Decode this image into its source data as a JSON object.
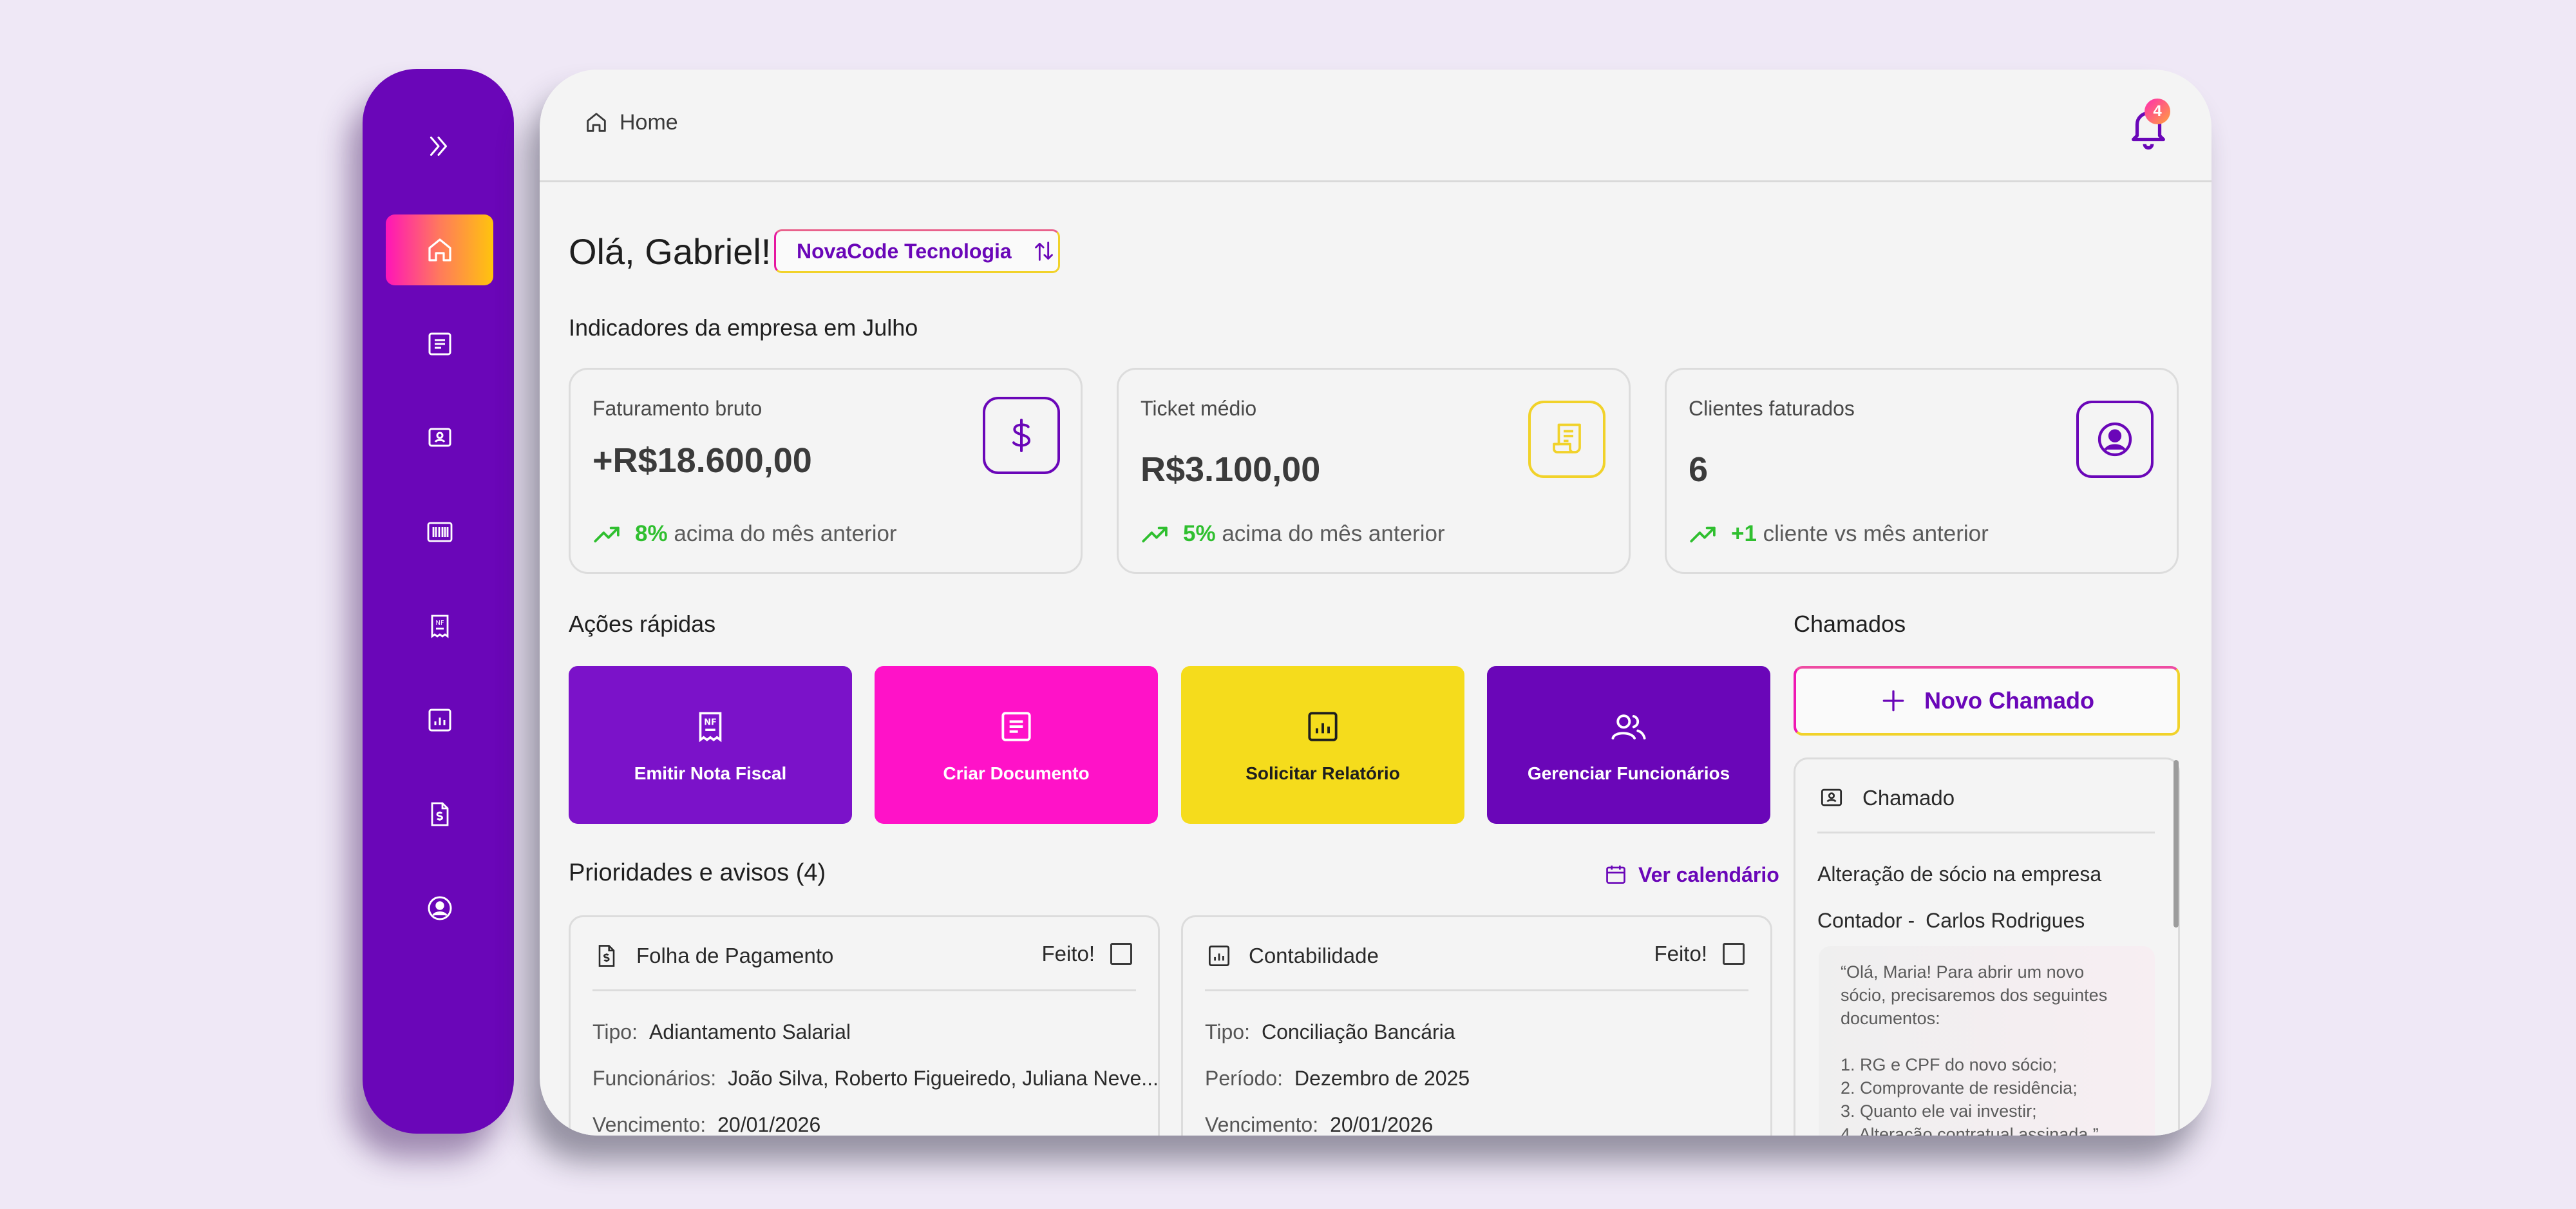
{
  "breadcrumb": {
    "label": "Home"
  },
  "notifications": {
    "count": "4"
  },
  "greeting": "Olá, Gabriel!",
  "company": {
    "name": "NovaCode Tecnologia"
  },
  "indicators": {
    "title": "Indicadores da empresa em Julho",
    "cards": [
      {
        "label": "Faturamento bruto",
        "value": "+R$18.600,00",
        "pct": "8%",
        "trend_text": "acima do mês anterior",
        "icon": "dollar-icon",
        "accent": "#6a06b8"
      },
      {
        "label": "Ticket médio",
        "value": "R$3.100,00",
        "pct": "5%",
        "trend_text": "acima do mês anterior",
        "icon": "receipt-icon",
        "accent": "#f1d22a"
      },
      {
        "label": "Clientes faturados",
        "value": "6",
        "pct": "+1",
        "trend_text": "cliente vs mês anterior",
        "icon": "user-circle-icon",
        "accent": "#6a06b8"
      }
    ]
  },
  "quick_actions": {
    "title": "Ações rápidas",
    "items": [
      {
        "label": "Emitir Nota Fiscal",
        "icon": "invoice-icon",
        "bg": "#7b12c9",
        "fg": "#ffffff"
      },
      {
        "label": "Criar Documento",
        "icon": "document-icon",
        "bg": "#ff12c8",
        "fg": "#ffffff"
      },
      {
        "label": "Solicitar Relatório",
        "icon": "report-icon",
        "bg": "#f5dc1c",
        "fg": "#1e1e1e"
      },
      {
        "label": "Gerenciar Funcionários",
        "icon": "users-icon",
        "bg": "#6a06b8",
        "fg": "#ffffff"
      }
    ]
  },
  "tickets": {
    "title": "Chamados",
    "new_button": "Novo Chamado",
    "card": {
      "header": "Chamado",
      "subject": "Alteração de sócio na empresa",
      "contact_label": "Contador -",
      "contact_name": "Carlos Rodrigues",
      "message": [
        "“Olá, Maria! Para abrir um novo",
        "sócio, precisaremos dos seguintes",
        "documentos:",
        "",
        "1. RG e CPF do novo sócio;",
        "2. Comprovante de residência;",
        "3. Quanto ele vai investir;",
        "4. Alteração contratual assinada.”"
      ]
    }
  },
  "priorities": {
    "title": "Prioridades e avisos (4)",
    "calendar_link": "Ver calendário",
    "items": [
      {
        "title": "Folha de Pagamento",
        "done_label": "Feito!",
        "icon": "payroll-icon",
        "rows": [
          {
            "label": "Tipo:",
            "value": "Adiantamento Salarial"
          },
          {
            "label": "Funcionários:",
            "value": "João Silva, Roberto Figueiredo, Juliana Neve..."
          },
          {
            "label": "Vencimento:",
            "value": "20/01/2026"
          }
        ]
      },
      {
        "title": "Contabilidade",
        "done_label": "Feito!",
        "icon": "report-icon",
        "rows": [
          {
            "label": "Tipo:",
            "value": "Conciliação Bancária"
          },
          {
            "label": "Período:",
            "value": "Dezembro de 2025"
          },
          {
            "label": "Vencimento:",
            "value": "20/01/2026"
          }
        ]
      }
    ]
  },
  "sidebar": {
    "bg": "#6a06b8",
    "items": [
      {
        "icon": "home-icon",
        "active": true
      },
      {
        "icon": "document-icon"
      },
      {
        "icon": "contact-card-icon"
      },
      {
        "icon": "barcode-icon"
      },
      {
        "icon": "invoice-icon"
      },
      {
        "icon": "report-icon"
      },
      {
        "icon": "dollar-file-icon"
      },
      {
        "icon": "user-circle-icon"
      }
    ]
  }
}
